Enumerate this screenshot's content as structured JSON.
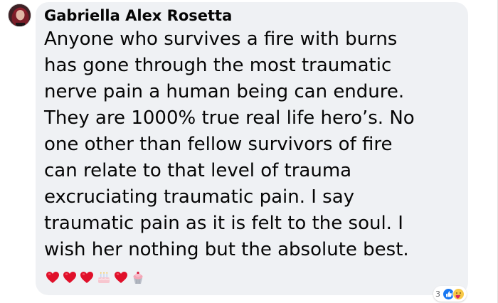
{
  "comment": {
    "author": "Gabriella Alex Rosetta",
    "lines": [
      "Anyone who survives a fire with burns",
      "has gone through the most traumatic",
      "nerve pain a human being can endure.",
      "They are 1000% true real life hero’s. No",
      "one other than fellow survivors of fire",
      "can relate to that level of trauma",
      "excruciating traumatic pain. I say",
      "traumatic pain as it is felt to the soul. I",
      "wish her nothing but the absolute best."
    ],
    "emojis": [
      "heart-icon",
      "heart-icon",
      "heart-icon",
      "birthday-cake-icon",
      "heart-icon",
      "cupcake-icon"
    ]
  },
  "reactions": {
    "count": "3",
    "icons": [
      "like-icon",
      "care-icon"
    ]
  },
  "colors": {
    "bubble_bg": "#eff1f4",
    "text": "#050505",
    "heart": "#e0102a",
    "like_blue": "#1877f2",
    "care_yellow": "#f7c948"
  }
}
